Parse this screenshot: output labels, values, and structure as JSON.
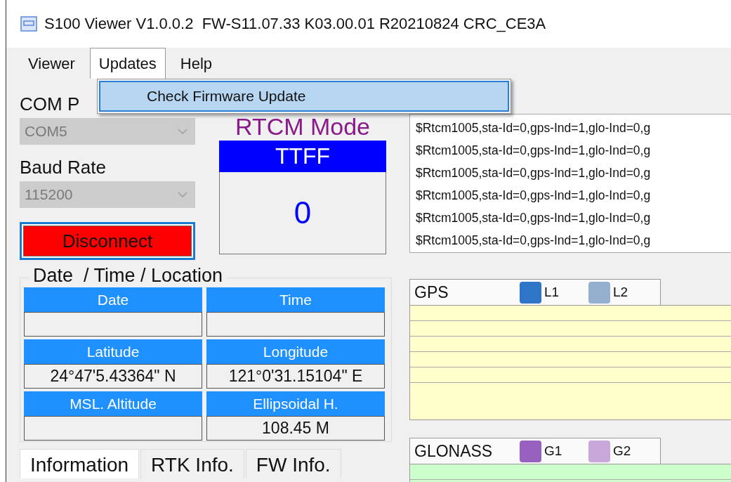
{
  "window": {
    "title": "S100 Viewer V1.0.0.2  FW-S11.07.33 K03.00.01 R20210824 CRC_CE3A"
  },
  "menu": [
    {
      "label": "Viewer",
      "selected": false
    },
    {
      "label": "Updates",
      "selected": true
    },
    {
      "label": "Help",
      "selected": false
    }
  ],
  "dropdown": {
    "items": [
      {
        "label": "Check Firmware Update",
        "selected": true
      }
    ]
  },
  "connection": {
    "com_port_label": "COM P",
    "com_port": {
      "value": "COM5",
      "disabled": true
    },
    "baud_label": "Baud Rate",
    "baud_rate": {
      "value": "115200",
      "disabled": true
    },
    "button": "Disconnect"
  },
  "mode_label": "RTCM Mode",
  "ttff": {
    "label": "TTFF",
    "value": "0"
  },
  "log": [
    "$Rtcm1005,sta-Id=0,gps-Ind=1,glo-Ind=0,g",
    "$Rtcm1005,sta-Id=0,gps-Ind=1,glo-Ind=0,g",
    "$Rtcm1005,sta-Id=0,gps-Ind=1,glo-Ind=0,g",
    "$Rtcm1005,sta-Id=0,gps-Ind=1,glo-Ind=0,g",
    "$Rtcm1005,sta-Id=0,gps-Ind=1,glo-Ind=0,g",
    "$Rtcm1005,sta-Id=0,gps-Ind=1,glo-Ind=0,g"
  ],
  "location": {
    "title": "Date  / Time / Location",
    "fields": [
      {
        "label": "Date"
      },
      {
        "label": "Time"
      },
      {
        "label": "Latitude",
        "value": "24°47'5.43364\" N"
      },
      {
        "label": "Longitude",
        "value": "121°0'31.15104\" E"
      },
      {
        "label": "MSL. Altitude"
      },
      {
        "label": "Ellipsoidal H.",
        "value": "108.45 M"
      }
    ]
  },
  "tabs": [
    {
      "label": "Information",
      "selected": true
    },
    {
      "label": "RTK Info.",
      "selected": false
    },
    {
      "label": "FW Info.",
      "selected": false
    }
  ],
  "constellations": [
    {
      "name": "GPS",
      "color": "#ffffcc",
      "legend": [
        {
          "label": "L1",
          "color": "#2e75c8"
        },
        {
          "label": "L2",
          "color": "#95b0cf"
        }
      ]
    },
    {
      "name": "GLONASS",
      "color": "#ccffcc",
      "legend": [
        {
          "label": "G1",
          "color": "#9860bf"
        },
        {
          "label": "G2",
          "color": "#c8a8da"
        }
      ]
    }
  ]
}
